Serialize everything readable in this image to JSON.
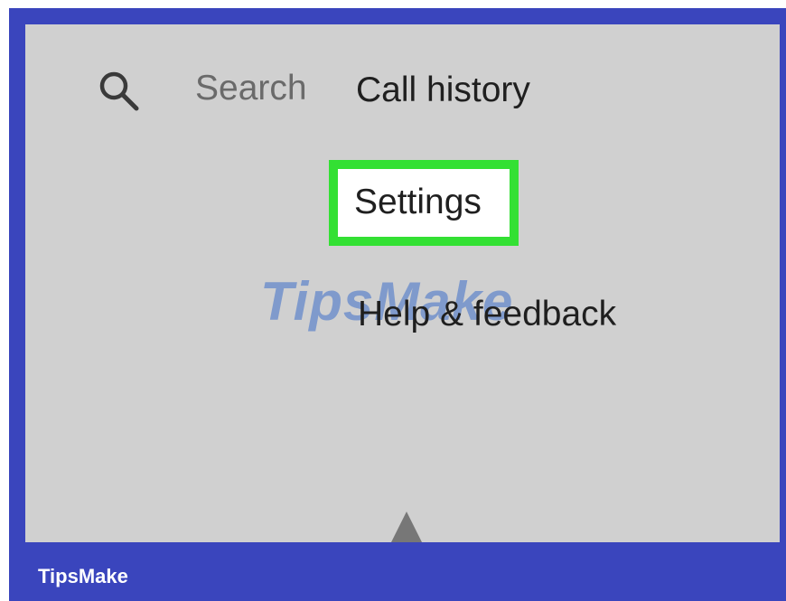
{
  "search": {
    "icon": "search-icon",
    "label": "Search"
  },
  "menu": {
    "items": [
      {
        "label": "Call history"
      },
      {
        "label": "Settings"
      },
      {
        "label": "Help & feedback"
      }
    ]
  },
  "watermark": {
    "text": "TipsMake"
  },
  "footer": {
    "brand": "TipsMake"
  },
  "colors": {
    "frame": "#3a45bd",
    "screen": "#d0d0d0",
    "highlight": "#33e033"
  }
}
